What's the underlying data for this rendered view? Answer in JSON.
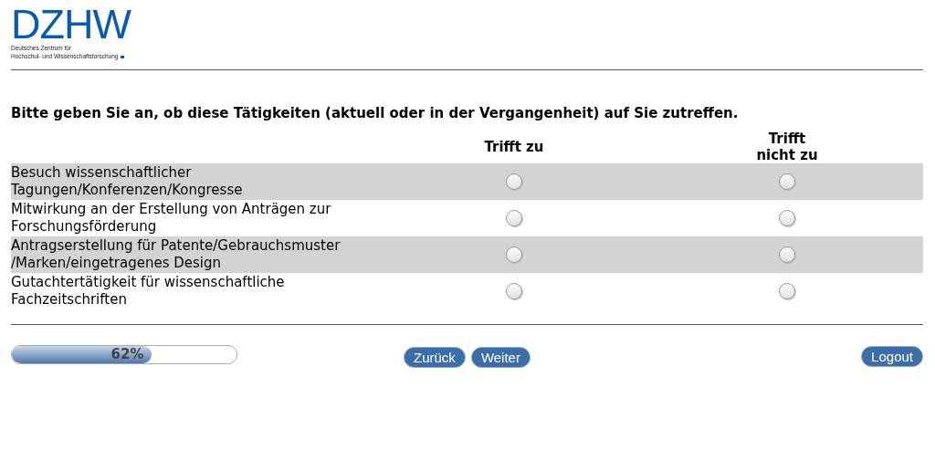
{
  "logo": {
    "wordmark": "DZHW",
    "subtitle_lines": [
      "Deutsches Zentrum für",
      "Hochschul- und Wissenschaftsforschung"
    ]
  },
  "question": "Bitte geben Sie an, ob diese Tätigkeiten (aktuell oder in der Vergangenheit) auf Sie zutreffen.",
  "columns": [
    "Trifft zu",
    "Trifft nicht zu"
  ],
  "rows": [
    {
      "label": "Besuch wissenschaftlicher Tagungen/Konferenzen/Kongresse",
      "options": [
        {
          "selected": false
        },
        {
          "selected": false
        }
      ]
    },
    {
      "label": "Mitwirkung an der Erstellung von Anträgen zur Forschungsförderung",
      "options": [
        {
          "selected": false
        },
        {
          "selected": false
        }
      ]
    },
    {
      "label": "Antragserstellung für Patente/Gebrauchsmuster /Marken/eingetragenes Design",
      "options": [
        {
          "selected": false
        },
        {
          "selected": false
        }
      ]
    },
    {
      "label": "Gutachtertätigkeit für wissenschaftliche Fachzeitschriften",
      "options": [
        {
          "selected": false
        },
        {
          "selected": false
        }
      ]
    }
  ],
  "progress": {
    "level": 0.62,
    "reading": "62%"
  },
  "nav_buttons": [
    "Zurück",
    "Weiter"
  ],
  "logout": "Logout"
}
